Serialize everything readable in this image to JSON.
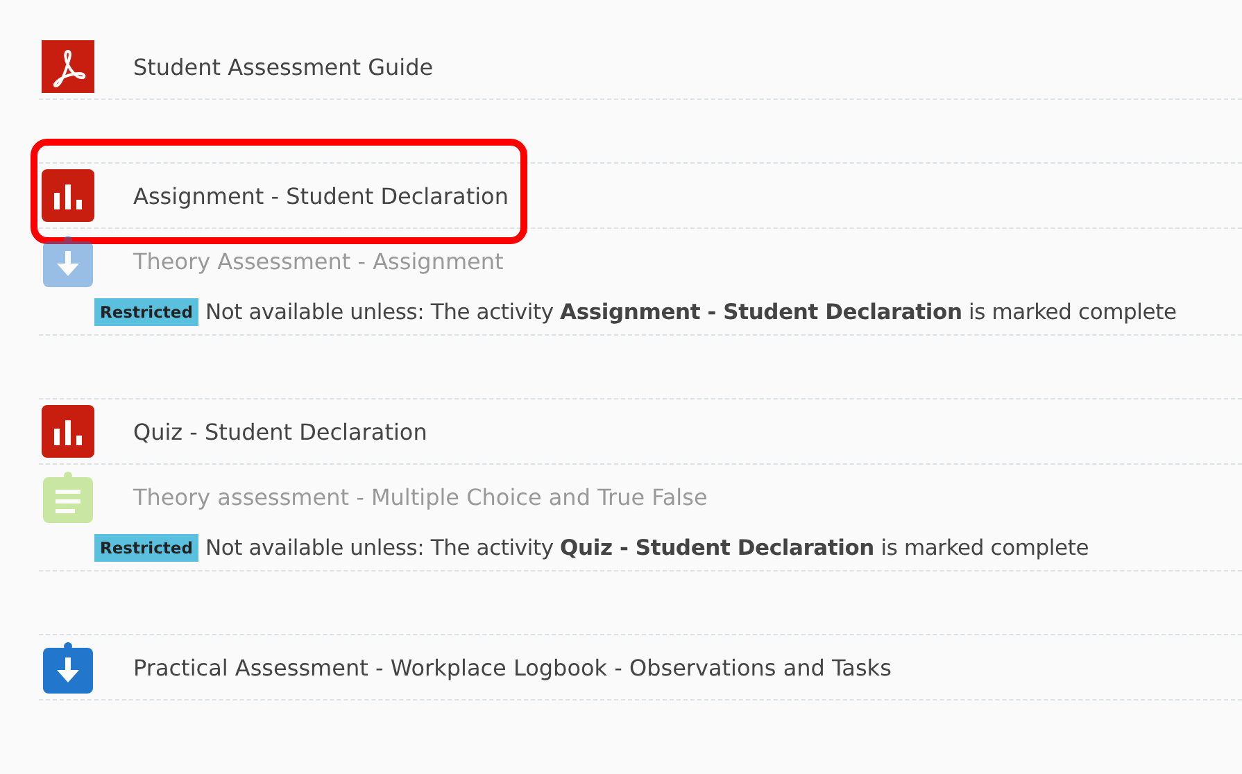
{
  "sections": [
    {
      "activities": [
        {
          "kind": "pdf",
          "title": "Student Assessment Guide",
          "dimmed": false,
          "highlighted": false
        }
      ]
    },
    {
      "activities": [
        {
          "kind": "feedback",
          "title": "Assignment - Student Declaration",
          "dimmed": false,
          "highlighted": true
        },
        {
          "kind": "assign",
          "title": "Theory Assessment - Assignment",
          "dimmed": true,
          "highlighted": false,
          "restriction": {
            "badge": "Restricted",
            "text": "Not available unless: The activity **Assignment - Student Declaration** is marked complete"
          }
        }
      ]
    },
    {
      "activities": [
        {
          "kind": "feedback",
          "title": "Quiz - Student Declaration",
          "dimmed": false,
          "highlighted": false
        },
        {
          "kind": "quiz",
          "title": "Theory assessment - Multiple Choice and True False",
          "dimmed": true,
          "highlighted": false,
          "restriction": {
            "badge": "Restricted",
            "text": "Not available unless: The activity **Quiz - Student Declaration** is marked complete"
          }
        }
      ]
    },
    {
      "activities": [
        {
          "kind": "assign",
          "title": "Practical Assessment - Workplace Logbook - Observations and Tasks",
          "dimmed": false,
          "highlighted": false
        }
      ]
    }
  ]
}
